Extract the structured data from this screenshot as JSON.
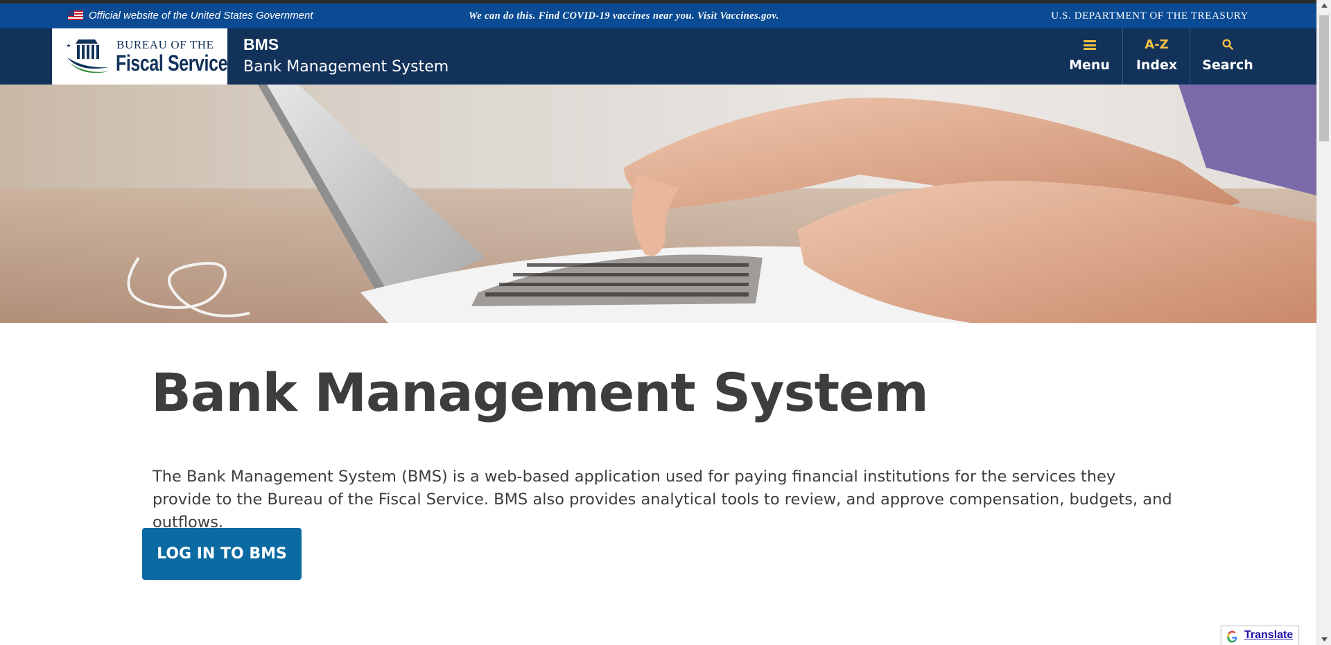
{
  "banner": {
    "official_text": "Official website of the United States Government",
    "covid_text": "We can do this. Find COVID-19 vaccines near you. Visit Vaccines.gov.",
    "department_text": "U.S. DEPARTMENT OF THE TREASURY"
  },
  "header": {
    "logo_line1": "BUREAU OF THE",
    "logo_line2": "Fiscal Service",
    "site_abbr": "BMS",
    "site_name": "Bank Management System",
    "nav": {
      "menu_label": "Menu",
      "index_glyph": "A-Z",
      "index_label": "Index",
      "search_label": "Search"
    }
  },
  "hero": {
    "icon": "laptop-typing-photo"
  },
  "main": {
    "title": "Bank Management System",
    "intro": "The Bank Management System (BMS) is a web-based application used for paying financial institutions for the services they provide to the Bureau of the Fiscal Service. BMS also provides analytical tools to review, and approve compensation, budgets, and outflows.",
    "login_button": "LOG IN TO BMS"
  },
  "translate": {
    "label": "Translate"
  },
  "colors": {
    "banner_blue": "#0b4b93",
    "header_navy": "#12325a",
    "accent_gold": "#f5c242",
    "button_blue": "#0b6aa2",
    "text_dark": "#3d3d3d"
  }
}
